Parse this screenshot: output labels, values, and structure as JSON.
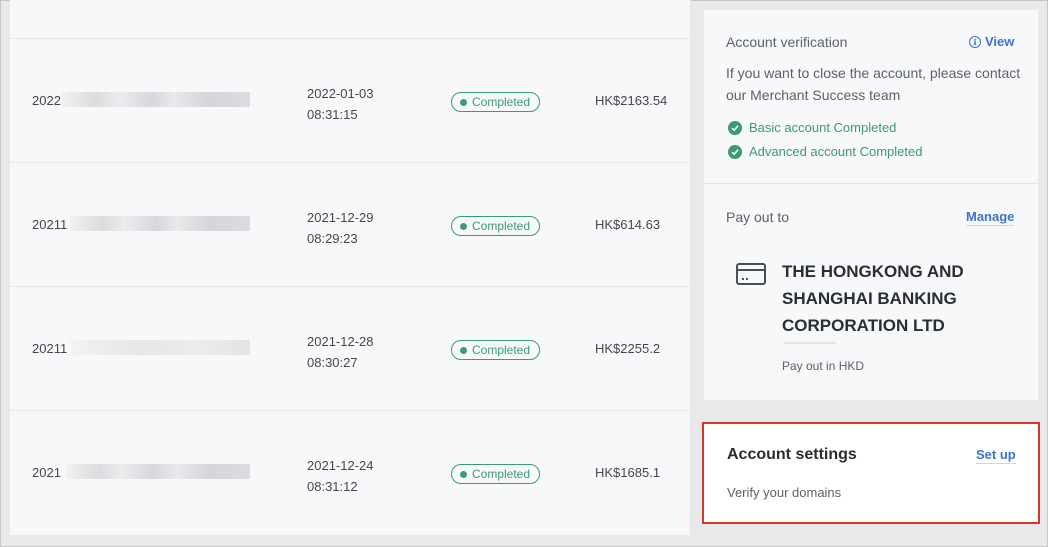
{
  "payouts": [
    {
      "id_prefix": "2022",
      "date": "2022-01-03",
      "time": "08:31:15",
      "status": "Completed",
      "amount": "HK$2163.54"
    },
    {
      "id_prefix": "20211",
      "date": "2021-12-29",
      "time": "08:29:23",
      "status": "Completed",
      "amount": "HK$614.63"
    },
    {
      "id_prefix": "20211",
      "date": "2021-12-28",
      "time": "08:30:27",
      "status": "Completed",
      "amount": "HK$2255.2"
    },
    {
      "id_prefix": "2021",
      "date": "2021-12-24",
      "time": "08:31:12",
      "status": "Completed",
      "amount": "HK$1685.1"
    }
  ],
  "verification": {
    "title": "Account verification",
    "view_label": "View",
    "description": "If you want to close the account, please contact our Merchant Success team",
    "checks": [
      "Basic account Completed",
      "Advanced account Completed"
    ]
  },
  "payout_to": {
    "title": "Pay out to",
    "manage_label": "Manage",
    "bank_name": "THE HONGKONG AND SHANGHAI BANKING CORPORATION LTD",
    "currency_note": "Pay out in HKD"
  },
  "settings": {
    "title": "Account settings",
    "setup_label": "Set up",
    "description": "Verify your domains"
  },
  "colors": {
    "success": "#3b9b72",
    "link": "#3f72c9",
    "highlight_border": "#d9352a"
  }
}
